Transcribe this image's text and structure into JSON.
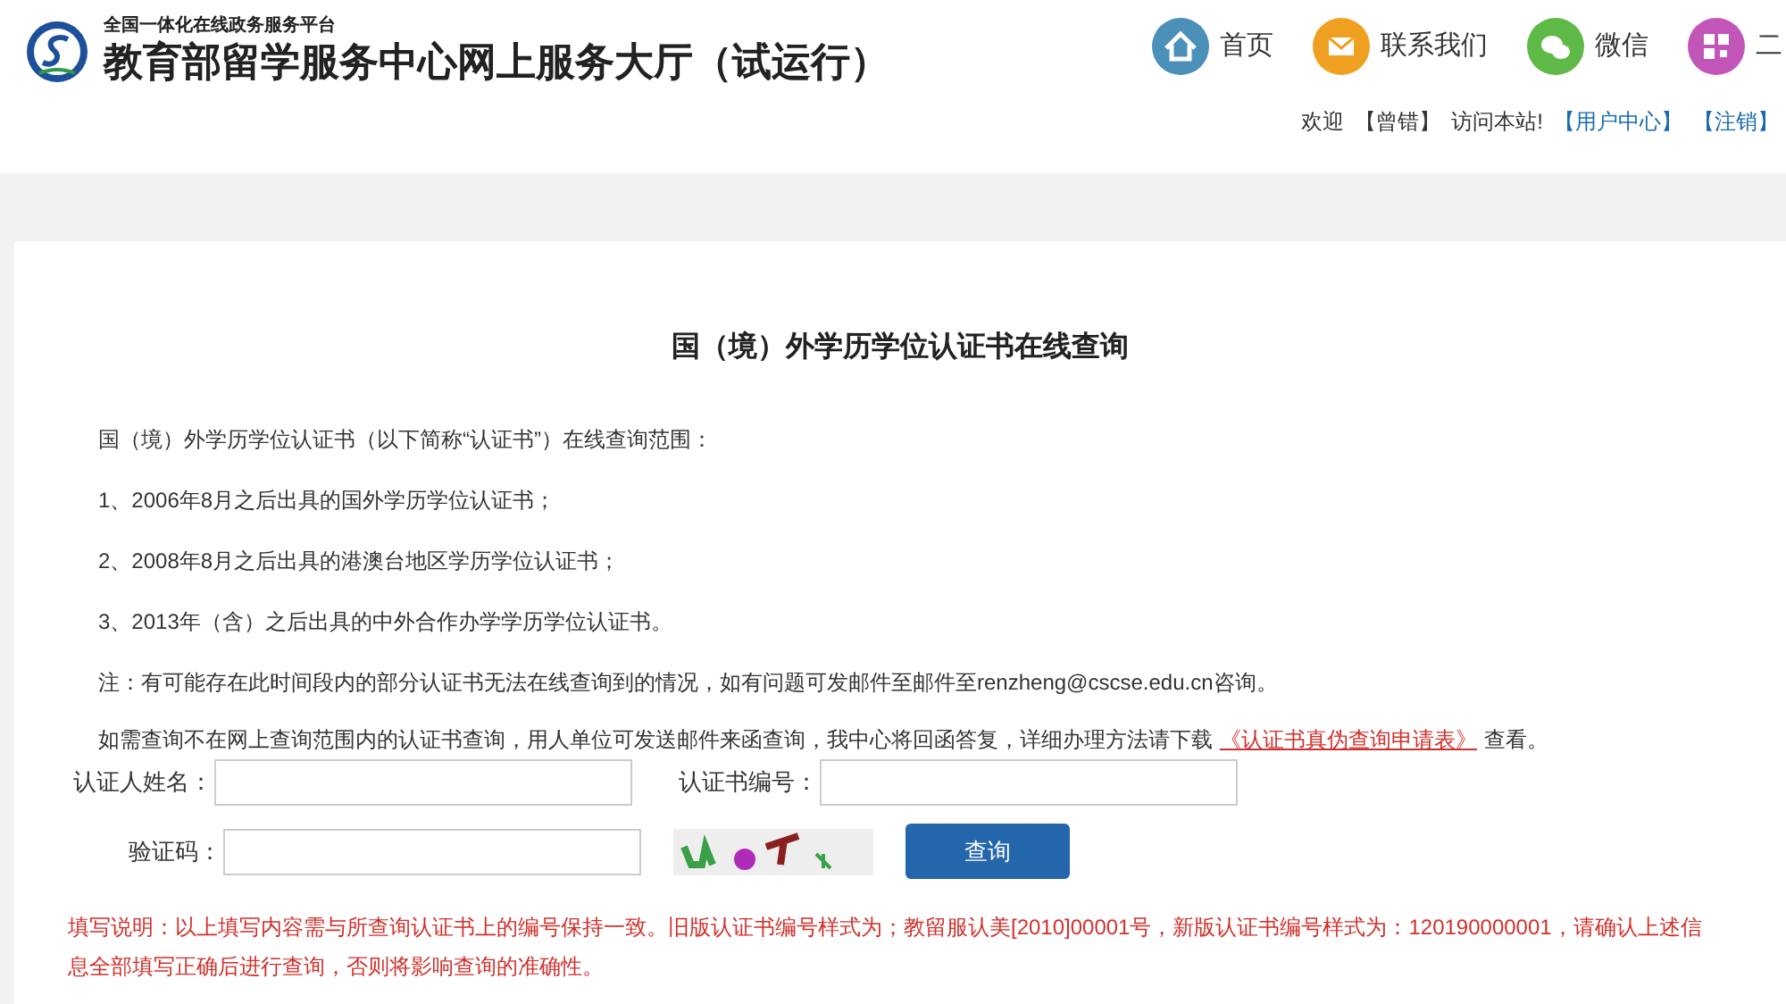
{
  "header": {
    "subtitle": "全国一体化在线政务服务平台",
    "title": "教育部留学服务中心网上服务大厅（试运行）",
    "nav": [
      {
        "kind": "home",
        "label": "首页"
      },
      {
        "kind": "mail",
        "label": "联系我们"
      },
      {
        "kind": "wechat",
        "label": "微信"
      },
      {
        "kind": "qr",
        "label": "二"
      }
    ],
    "welcome": [
      "欢迎",
      "【曾错】",
      "访问本站!"
    ],
    "links": [
      "【用户中心】",
      "【注销】"
    ]
  },
  "card": {
    "heading": "国（境）外学历学位认证书在线查询",
    "paragraphs": [
      "国（境）外学历学位认证书（以下简称“认证书”）在线查询范围：",
      "1、2006年8月之后出具的国外学历学位认证书；",
      "2、2008年8月之后出具的港澳台地区学历学位认证书；",
      "3、2013年（含）之后出具的中外合作办学学历学位认证书。",
      "注：有可能存在此时间段内的部分认证书无法在线查询到的情况，如有问题可发邮件至邮件至renzheng@cscse.edu.cn咨询。"
    ],
    "download": {
      "before": "如需查询不在网上查询范围内的认证书查询，用人单位可发送邮件来函查询，我中心将回函答复，详细办理方法请下载",
      "link": "《认证书真伪查询申请表》",
      "after": "查看。"
    },
    "fields": {
      "name_label": "认证人姓名：",
      "number_label": "认证书编号：",
      "captcha_label": "验证码："
    },
    "query_button": "查询",
    "note": "填写说明：以上填写内容需与所查询认证书上的编号保持一致。旧版认证书编号样式为；教留服认美[2010]00001号，新版认证书编号样式为：120190000001，请确认上述信息全部填写正确后进行查询，否则将影响查询的准确性。"
  }
}
